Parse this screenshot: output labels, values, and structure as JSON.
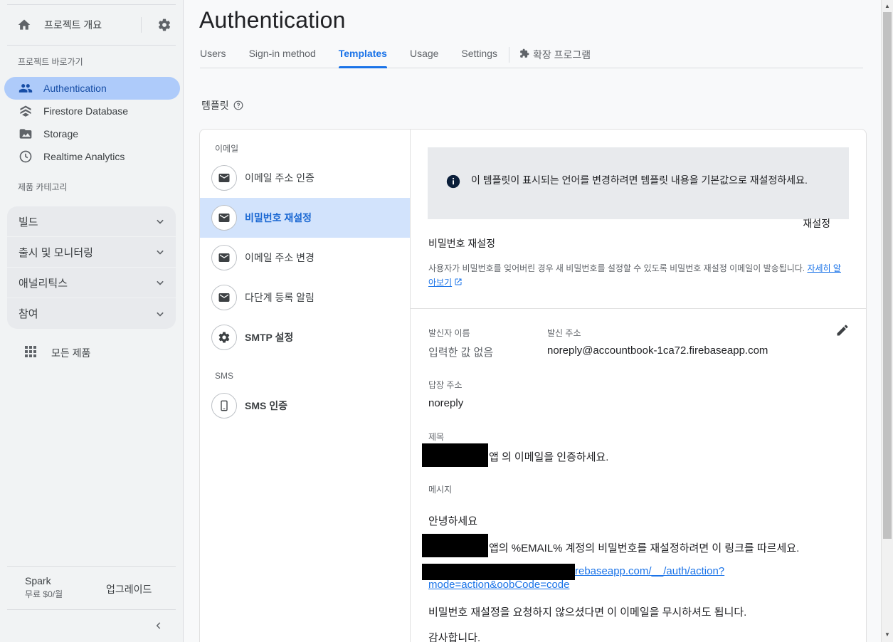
{
  "sidebar": {
    "overview_label": "프로젝트 개요",
    "shortcuts_title": "프로젝트 바로가기",
    "shortcuts": [
      {
        "label": "Authentication"
      },
      {
        "label": "Firestore Database"
      },
      {
        "label": "Storage"
      },
      {
        "label": "Realtime Analytics"
      }
    ],
    "categories_title": "제품 카테고리",
    "categories": [
      {
        "label": "빌드"
      },
      {
        "label": "출시 및 모니터링"
      },
      {
        "label": "애널리틱스"
      },
      {
        "label": "참여"
      }
    ],
    "all_products": "모든 제품",
    "plan_name": "Spark",
    "plan_price": "무료 $0/월",
    "upgrade": "업그레이드"
  },
  "main": {
    "title": "Authentication",
    "tabs": [
      {
        "label": "Users"
      },
      {
        "label": "Sign-in method"
      },
      {
        "label": "Templates"
      },
      {
        "label": "Usage"
      },
      {
        "label": "Settings"
      }
    ],
    "extensions_tab": "확장 프로그램",
    "templates_heading": "템플릿"
  },
  "templates": {
    "email_group": "이메일",
    "email_items": [
      {
        "label": "이메일 주소 인증"
      },
      {
        "label": "비밀번호 재설정"
      },
      {
        "label": "이메일 주소 변경"
      },
      {
        "label": "다단계 등록 알림"
      },
      {
        "label": "SMTP 설정"
      }
    ],
    "sms_group": "SMS",
    "sms_item": "SMS 인증"
  },
  "detail": {
    "notice": "이 템플릿이 표시되는 언어를 변경하려면 템플릿 내용을 기본값으로 재설정하세요.",
    "reset": "재설정",
    "name": "비밀번호 재설정",
    "description": "사용자가 비밀번호를 잊어버린 경우 새 비밀번호를 설정할 수 있도록 비밀번호 재설정 이메일이 발송됩니다.",
    "learn_more": "자세히 알아보기",
    "sender_name_label": "발신자 이름",
    "sender_name_value": "입력한 값 없음",
    "from_label": "발신 주소",
    "from_value": "noreply@accountbook-1ca72.firebaseapp.com",
    "reply_label": "답장 주소",
    "reply_value": "noreply",
    "subject_label": "제목",
    "subject_value": "앱 의 이메일을 인증하세요.",
    "message_label": "메시지",
    "msg_greeting": "안녕하세요",
    "msg_body": "앱의 %EMAIL% 계정의 비밀번호를 재설정하려면 이 링크를 따르세요.",
    "msg_link_1": "rebaseapp.com/__/auth/action?",
    "msg_link_2": "mode=action&oobCode=code",
    "msg_ignore": "비밀번호 재설정을 요청하지 않으셨다면 이 이메일을 무시하셔도 됩니다.",
    "msg_thanks": "감사합니다."
  },
  "colors": {
    "accent": "#1a73e8",
    "active_nav_bg": "#aecbfa",
    "active_item_bg": "#d2e3fc"
  }
}
